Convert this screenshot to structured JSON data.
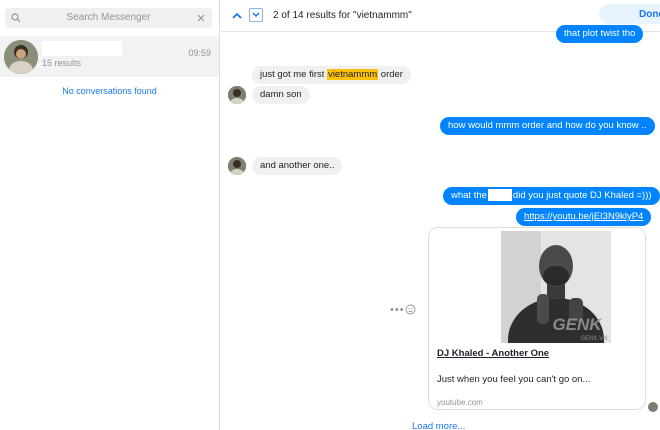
{
  "search": {
    "placeholder": "Search Messenger"
  },
  "conversation": {
    "results": "15 results",
    "time": "09:59"
  },
  "sidebar": {
    "empty_text": "No conversations found"
  },
  "topbar": {
    "result_count": "2 of 14 results for \"vietnammm\"",
    "done_label": "Done"
  },
  "messages": {
    "m1": "that plot twist tho",
    "m2_pre": "just got me first ",
    "m2_hl": "vietnammm",
    "m2_post": " order",
    "m3": "damn son",
    "m4": "how would mmm order and how do you know ..",
    "m5": "and another one..",
    "m6_pre": "what the",
    "m6_post": "did you just quote DJ Khaled =)))",
    "m7": "https://youtu.be/jEI3N9klyP4"
  },
  "card": {
    "title": "DJ Khaled - Another One",
    "description": "Just when you feel you can't go on...",
    "domain": "youtube.com",
    "watermark": "GENK",
    "watermark_sub": "GENK.VN"
  },
  "actions": {
    "more": "•••",
    "load_more": "Load more..."
  },
  "colors": {
    "accent": "#0084ff",
    "highlight": "#ffc107",
    "link": "#1877f2"
  }
}
